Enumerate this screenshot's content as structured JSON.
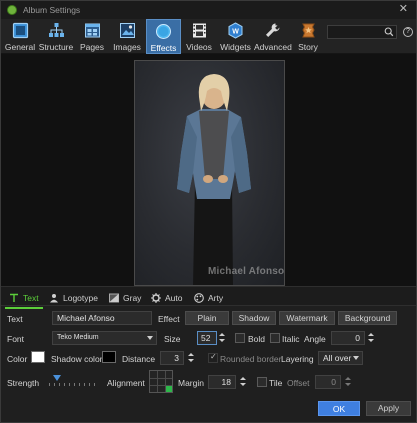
{
  "window": {
    "title": "Album Settings"
  },
  "toolbar": {
    "items": [
      {
        "label": "General",
        "icon": "general-icon"
      },
      {
        "label": "Structure",
        "icon": "structure-icon"
      },
      {
        "label": "Pages",
        "icon": "pages-icon"
      },
      {
        "label": "Images",
        "icon": "images-icon"
      },
      {
        "label": "Effects",
        "icon": "effects-icon",
        "active": true
      },
      {
        "label": "Videos",
        "icon": "film-icon"
      },
      {
        "label": "Widgets",
        "icon": "widgets-icon"
      },
      {
        "label": "Advanced",
        "icon": "wrench-icon"
      },
      {
        "label": "Story",
        "icon": "story-icon"
      }
    ],
    "search_value": "",
    "help_glyph": "?"
  },
  "preview": {
    "watermark_text": "Michael Afonso"
  },
  "tabs": [
    {
      "label": "Text",
      "active": true
    },
    {
      "label": "Logotype"
    },
    {
      "label": "Gray"
    },
    {
      "label": "Auto"
    },
    {
      "label": "Arty"
    }
  ],
  "form": {
    "text_label": "Text",
    "text_value": "Michael Afonso",
    "effect_label": "Effect",
    "effect_buttons": [
      "Plain",
      "Shadow",
      "Watermark",
      "Background"
    ],
    "font_label": "Font",
    "font_value": "Teko Medium",
    "size_label": "Size",
    "size_value": "52",
    "bold_label": "Bold",
    "italic_label": "Italic",
    "angle_label": "Angle",
    "angle_value": "0",
    "color_label": "Color",
    "shadow_color_label": "Shadow color",
    "distance_label": "Distance",
    "distance_value": "3",
    "rounded_border_label": "Rounded border",
    "layering_label": "Layering",
    "layering_value": "All over",
    "strength_label": "Strength",
    "alignment_label": "Alignment",
    "margin_label": "Margin",
    "margin_value": "18",
    "tile_label": "Tile",
    "offset_label": "Offset",
    "offset_value": "0",
    "text_color": "#ffffff",
    "shadow_color": "#000000"
  },
  "footer": {
    "ok_label": "OK",
    "apply_label": "Apply"
  }
}
